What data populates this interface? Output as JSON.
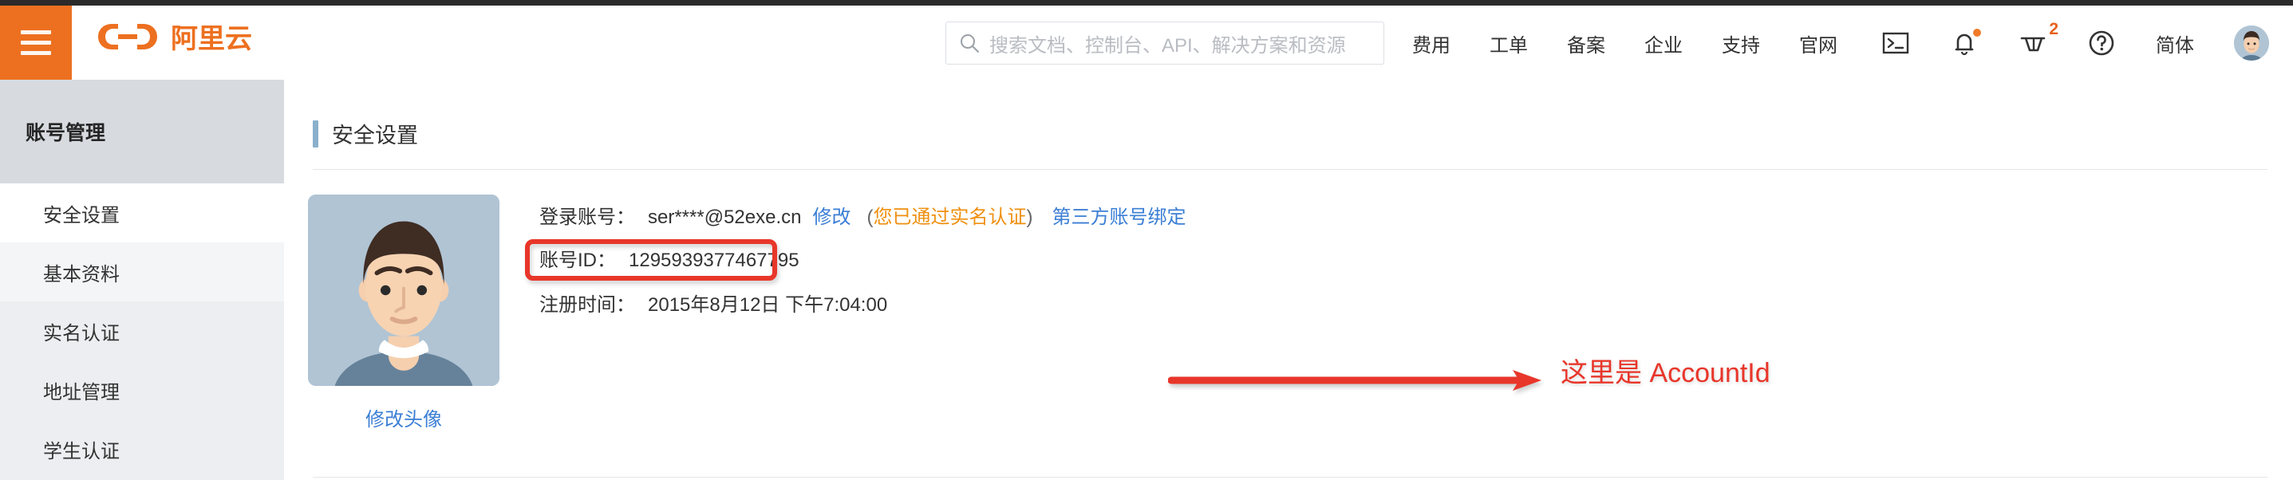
{
  "header": {
    "menu_icon": "hamburger-icon",
    "logo_text": "阿里云",
    "search": {
      "placeholder": "搜索文档、控制台、API、解决方案和资源",
      "icon": "search-icon"
    },
    "nav": [
      {
        "label": "费用"
      },
      {
        "label": "工单"
      },
      {
        "label": "备案"
      },
      {
        "label": "企业"
      },
      {
        "label": "支持"
      },
      {
        "label": "官网"
      }
    ],
    "icons": [
      {
        "name": "console-terminal-icon"
      },
      {
        "name": "bell-notification-icon",
        "has_dot": true
      },
      {
        "name": "shopping-cart-icon",
        "badge": "2"
      },
      {
        "name": "help-question-icon"
      }
    ],
    "language": "简体",
    "avatar": "user-avatar"
  },
  "sidebar": {
    "title": "账号管理",
    "items": [
      {
        "label": "安全设置",
        "active": true
      },
      {
        "label": "基本资料",
        "active": false
      },
      {
        "label": "实名认证",
        "active": false
      },
      {
        "label": "地址管理",
        "active": false
      },
      {
        "label": "学生认证",
        "active": false
      }
    ]
  },
  "main": {
    "page_title": "安全设置",
    "avatar_link": "修改头像",
    "rows": {
      "login_label": "登录账号：",
      "login_value": "ser****@52exe.cn",
      "login_modify": "修改",
      "verified_open": "(",
      "verified_text": "您已通过实名认证",
      "verified_close": ")",
      "third_party": "第三方账号绑定",
      "account_id_label": "账号ID：",
      "account_id_value": "1295939377467795",
      "register_label": "注册时间：",
      "register_value": "2015年8月12日 下午7:04:00"
    }
  },
  "annotation": {
    "text": "这里是 AccountId",
    "color": "#e8362a",
    "arrow": "right-arrow"
  },
  "colors": {
    "brand_orange": "#ed7020",
    "link_blue": "#3b7ed4",
    "warn_orange": "#ef9010",
    "annotation_red": "#e8362a",
    "sidebar_bg": "#eceef1",
    "sidebar_head_bg": "#d7dbe0",
    "title_bar": "#8bb0cc"
  }
}
